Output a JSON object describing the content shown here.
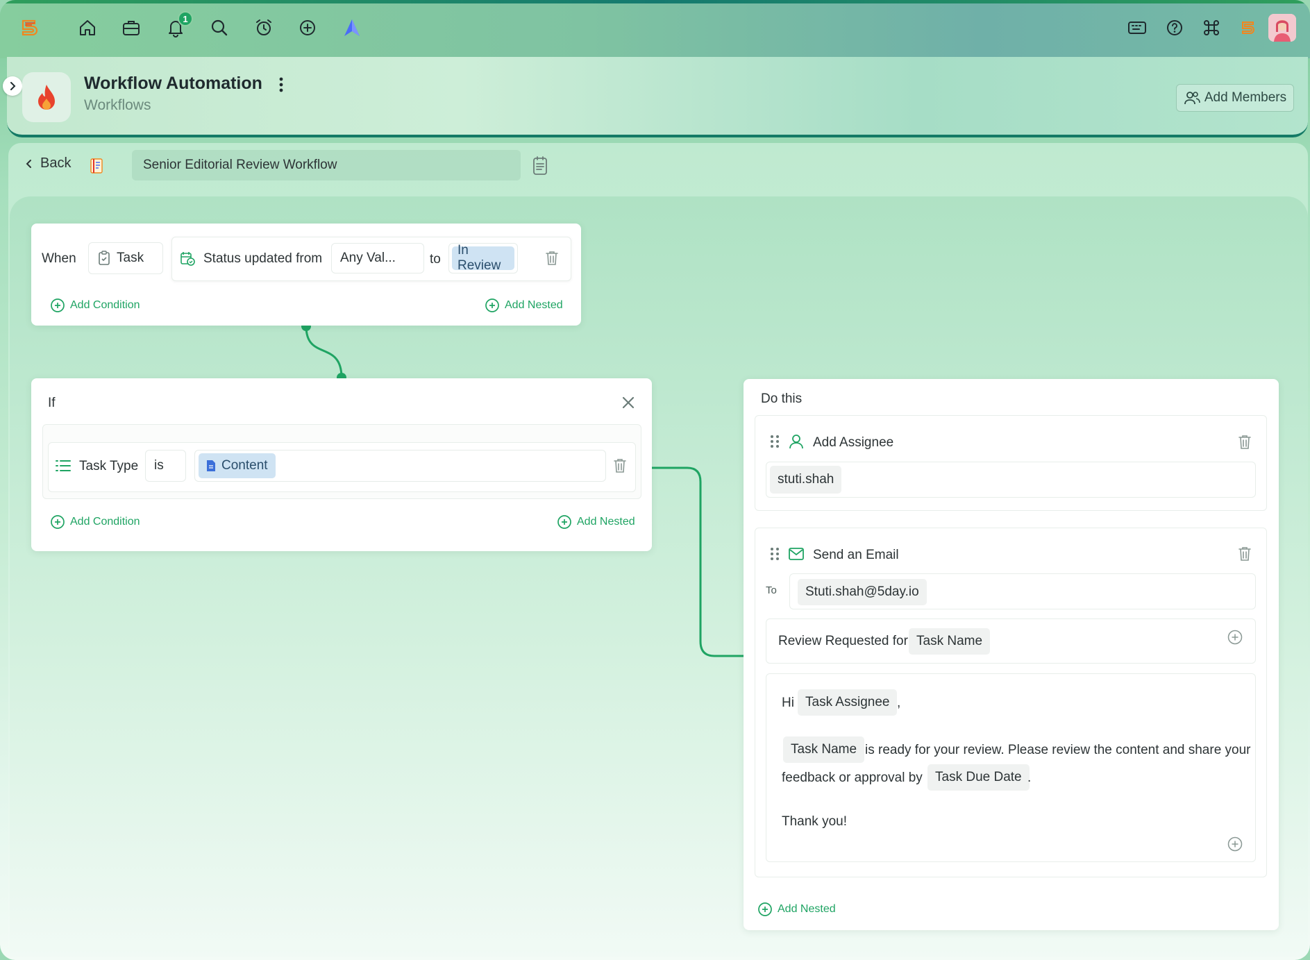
{
  "topbar": {
    "notification_count": "1",
    "icons": [
      "app-logo",
      "home-icon",
      "briefcase-icon",
      "bell-icon",
      "search-icon",
      "alarm-clock-icon",
      "plus-circle-icon",
      "arrow-up-icon",
      "keyboard-icon",
      "help-icon",
      "command-icon",
      "brand-logo",
      "avatar"
    ]
  },
  "header": {
    "title": "Workflow Automation",
    "subtitle": "Workflows",
    "add_members_label": "Add Members"
  },
  "toolbar": {
    "back_label": "Back",
    "workflow_name": "Senior Editorial Review Workflow"
  },
  "when": {
    "label": "When",
    "entity": "Task",
    "trigger": "Status updated from",
    "from_value": "Any Val...",
    "to_label": "to",
    "to_value": "In Review",
    "add_condition": "Add Condition",
    "add_nested": "Add Nested"
  },
  "if_block": {
    "label": "If",
    "field": "Task Type",
    "operator": "is",
    "value": "Content",
    "add_condition": "Add Condition",
    "add_nested": "Add Nested"
  },
  "do_block": {
    "label": "Do this",
    "add_assignee": {
      "title": "Add Assignee",
      "assignee": "stuti.shah"
    },
    "send_email": {
      "title": "Send an Email",
      "to_label": "To",
      "to_value": "Stuti.shah@5day.io",
      "subject_prefix": "Review Requested for",
      "subject_var": "Task Name",
      "body_greeting": "Hi",
      "body_var_assignee": "Task Assignee",
      "body_comma": ",",
      "body_var_taskname": "Task Name",
      "body_text_1": "is ready for your review. Please review the content and share your",
      "body_text_2": "feedback or approval by",
      "body_var_due": "Task Due Date",
      "body_period": ".",
      "body_signoff": "Thank you!"
    },
    "add_nested": "Add Nested"
  },
  "colors": {
    "accent": "#1fa463",
    "wire": "#1fa463",
    "tag_blue": "#cfe3f3"
  }
}
